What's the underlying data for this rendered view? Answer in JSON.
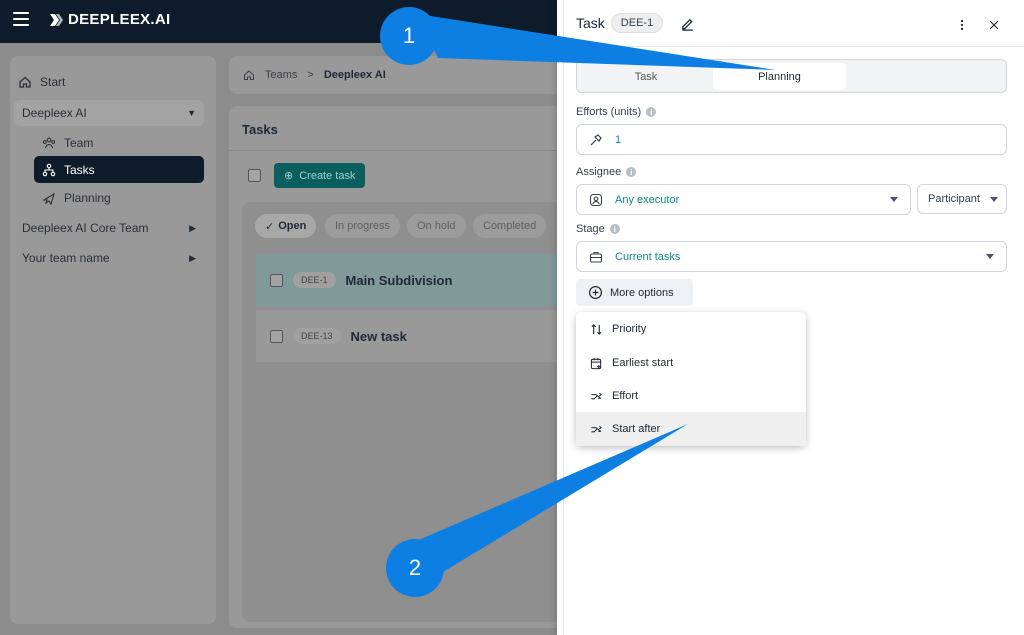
{
  "app": {
    "logo_text": "DEEPLEEX.AI"
  },
  "sidebar": {
    "start_label": "Start",
    "groups": [
      {
        "label": "Deepleex AI"
      },
      {
        "label": "Deepleex AI Core Team"
      },
      {
        "label": "Your team name"
      }
    ],
    "subitems": [
      {
        "label": "Team"
      },
      {
        "label": "Tasks"
      },
      {
        "label": "Planning"
      }
    ]
  },
  "breadcrumb": {
    "parent": "Teams",
    "separator": ">",
    "current": "Deepleex AI"
  },
  "tasks": {
    "title": "Tasks",
    "create_label": "Create task",
    "filters": [
      "Open",
      "In progress",
      "On hold",
      "Completed"
    ],
    "rows": [
      {
        "code": "DEE-1",
        "name": "Main Subdivision"
      },
      {
        "code": "DEE-13",
        "name": "New task"
      }
    ]
  },
  "panel": {
    "title": "Task",
    "badge": "DEE-1",
    "tabs": [
      "Task",
      "Planning"
    ],
    "active_tab": "Planning",
    "efforts": {
      "label": "Efforts (units)",
      "value": "1"
    },
    "assignee": {
      "label": "Assignee",
      "value": "Any executor",
      "role": "Participant"
    },
    "stage": {
      "label": "Stage",
      "value": "Current tasks"
    },
    "more_options_label": "More options",
    "menu": [
      {
        "label": "Priority",
        "icon": "sort-arrows-icon"
      },
      {
        "label": "Earliest start",
        "icon": "calendar-plus-icon"
      },
      {
        "label": "Effort",
        "icon": "split-arrows-icon"
      },
      {
        "label": "Start after",
        "icon": "split-arrows-icon"
      }
    ]
  },
  "callouts": [
    "1",
    "2"
  ],
  "colors": {
    "topbar": "#0d1b2a",
    "accent": "#0f8a8a",
    "callout": "#0d7fe3"
  }
}
